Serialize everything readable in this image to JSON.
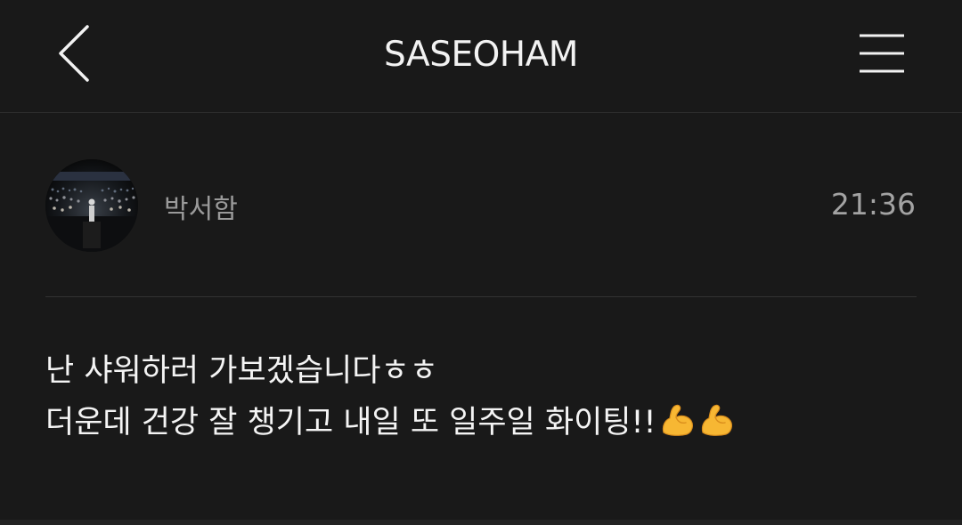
{
  "header": {
    "title": "SASEOHAM"
  },
  "post": {
    "author": "박서함",
    "time": "21:36",
    "message_line1": "난 샤워하러 가보겠습니다ㅎㅎ",
    "message_line2": "더운데 건강 잘 챙기고 내일 또 일주일 화이팅!!",
    "emojis": [
      "flexed-biceps",
      "flexed-biceps"
    ]
  },
  "colors": {
    "background": "#191919",
    "divider": "#333333",
    "muted_text": "#9a9a9a"
  }
}
